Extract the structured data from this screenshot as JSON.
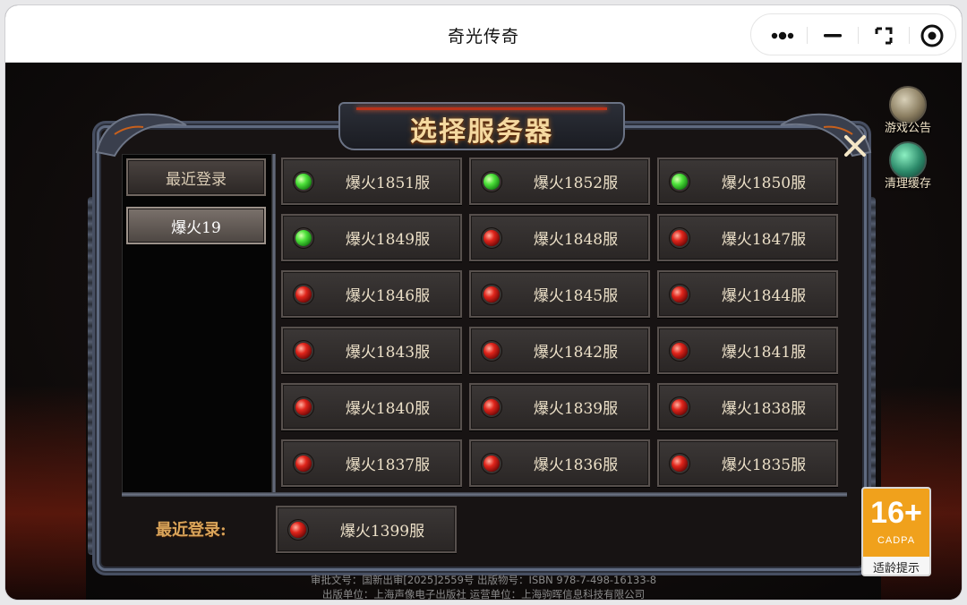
{
  "window": {
    "title": "奇光传奇"
  },
  "game": {
    "panel_title": "选择服务器",
    "side_buttons": {
      "notice": "游戏公告",
      "clear_cache": "清理缓存"
    },
    "tabs": [
      {
        "label": "最近登录",
        "active": false
      },
      {
        "label": "爆火19",
        "active": true
      }
    ],
    "servers": [
      {
        "name": "爆火1851服",
        "status": "green"
      },
      {
        "name": "爆火1852服",
        "status": "green"
      },
      {
        "name": "爆火1850服",
        "status": "green"
      },
      {
        "name": "爆火1849服",
        "status": "green"
      },
      {
        "name": "爆火1848服",
        "status": "red"
      },
      {
        "name": "爆火1847服",
        "status": "red"
      },
      {
        "name": "爆火1846服",
        "status": "red"
      },
      {
        "name": "爆火1845服",
        "status": "red"
      },
      {
        "name": "爆火1844服",
        "status": "red"
      },
      {
        "name": "爆火1843服",
        "status": "red"
      },
      {
        "name": "爆火1842服",
        "status": "red"
      },
      {
        "name": "爆火1841服",
        "status": "red"
      },
      {
        "name": "爆火1840服",
        "status": "red"
      },
      {
        "name": "爆火1839服",
        "status": "red"
      },
      {
        "name": "爆火1838服",
        "status": "red"
      },
      {
        "name": "爆火1837服",
        "status": "red"
      },
      {
        "name": "爆火1836服",
        "status": "red"
      },
      {
        "name": "爆火1835服",
        "status": "red"
      }
    ],
    "recent": {
      "label": "最近登录:",
      "server_name": "爆火1399服",
      "status": "red"
    },
    "footer": {
      "line1": "审批文号：国新出审[2025]2559号  出版物号：ISBN 978-7-498-16133-8",
      "line2": "出版单位：上海声像电子出版社  运营单位：上海驹晖信息科技有限公司"
    },
    "age_badge": {
      "rating": "16+",
      "org": "CADPA",
      "label": "适龄提示"
    }
  },
  "colors": {
    "status_green": "#4fe23c",
    "status_red": "#e0251b",
    "title_gold": "#f5d9a0",
    "recent_label": "#d9a45a"
  }
}
